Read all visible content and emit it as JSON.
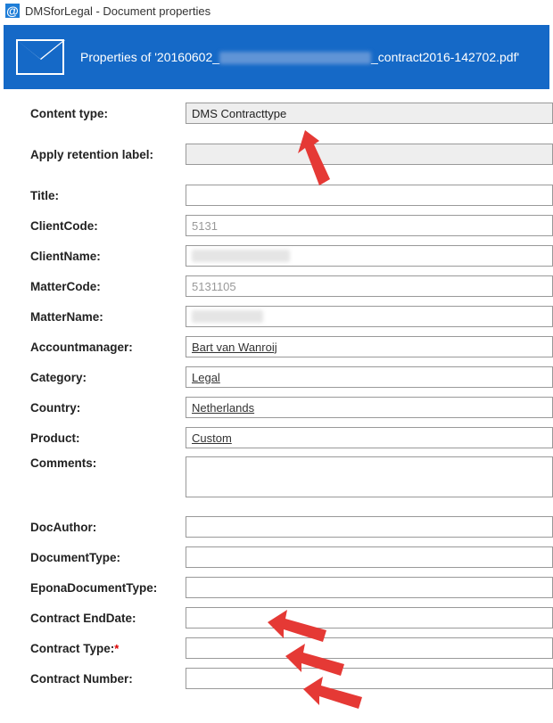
{
  "window": {
    "title": "DMSforLegal - Document properties",
    "app_icon_glyph": "@"
  },
  "header": {
    "prefix": "Properties of '20160602_",
    "suffix": "_contract2016-142702.pdf'"
  },
  "form": {
    "content_type": {
      "label": "Content type:",
      "value": "DMS Contracttype"
    },
    "retention": {
      "label": "Apply retention label:",
      "value": ""
    },
    "title": {
      "label": "Title:",
      "value": ""
    },
    "client_code": {
      "label": "ClientCode:",
      "value": "5131"
    },
    "client_name": {
      "label": "ClientName:",
      "value": ""
    },
    "matter_code": {
      "label": "MatterCode:",
      "value": "5131105"
    },
    "matter_name": {
      "label": "MatterName:",
      "value": ""
    },
    "account_manager": {
      "label": "Accountmanager:",
      "value": "Bart van Wanroij"
    },
    "category": {
      "label": "Category:",
      "value": "Legal"
    },
    "country": {
      "label": "Country:",
      "value": "Netherlands"
    },
    "product": {
      "label": "Product:",
      "value": "Custom"
    },
    "comments": {
      "label": "Comments:",
      "value": ""
    },
    "doc_author": {
      "label": "DocAuthor:",
      "value": ""
    },
    "document_type": {
      "label": "DocumentType:",
      "value": ""
    },
    "epona_doc_type": {
      "label": "EponaDocumentType:",
      "value": ""
    },
    "contract_end_date": {
      "label": "Contract EndDate:",
      "value": ""
    },
    "contract_type": {
      "label": "Contract Type:",
      "required": "*",
      "value": ""
    },
    "contract_number": {
      "label": "Contract Number:",
      "value": ""
    }
  }
}
